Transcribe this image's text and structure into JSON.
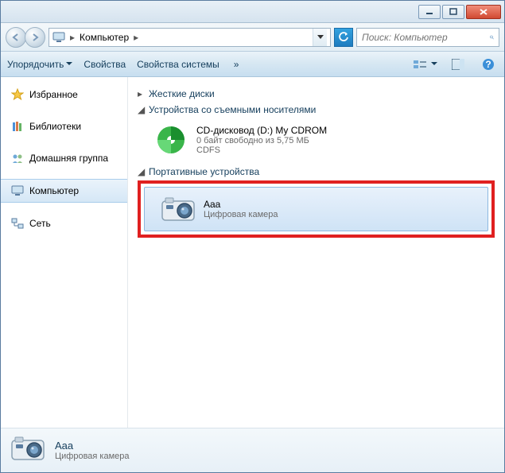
{
  "address": {
    "location": "Компьютер",
    "search_placeholder": "Поиск: Компьютер"
  },
  "toolbar": {
    "organize": "Упорядочить",
    "properties": "Свойства",
    "system_properties": "Свойства системы",
    "chevron": "»"
  },
  "sidebar": {
    "favorites": "Избранное",
    "libraries": "Библиотеки",
    "homegroup": "Домашняя группа",
    "computer": "Компьютер",
    "network": "Сеть"
  },
  "sections": {
    "hard_drives": "Жесткие диски",
    "removable": "Устройства со съемными носителями",
    "portable": "Портативные устройства"
  },
  "devices": {
    "cdrom": {
      "title": "CD-дисковод (D:) My CDROM",
      "line2": "0 байт свободно из 5,75 МБ",
      "line3": "CDFS"
    },
    "camera": {
      "title": "Aaa",
      "sub": "Цифровая камера"
    }
  },
  "details": {
    "title": "Aaa",
    "sub": "Цифровая камера"
  }
}
